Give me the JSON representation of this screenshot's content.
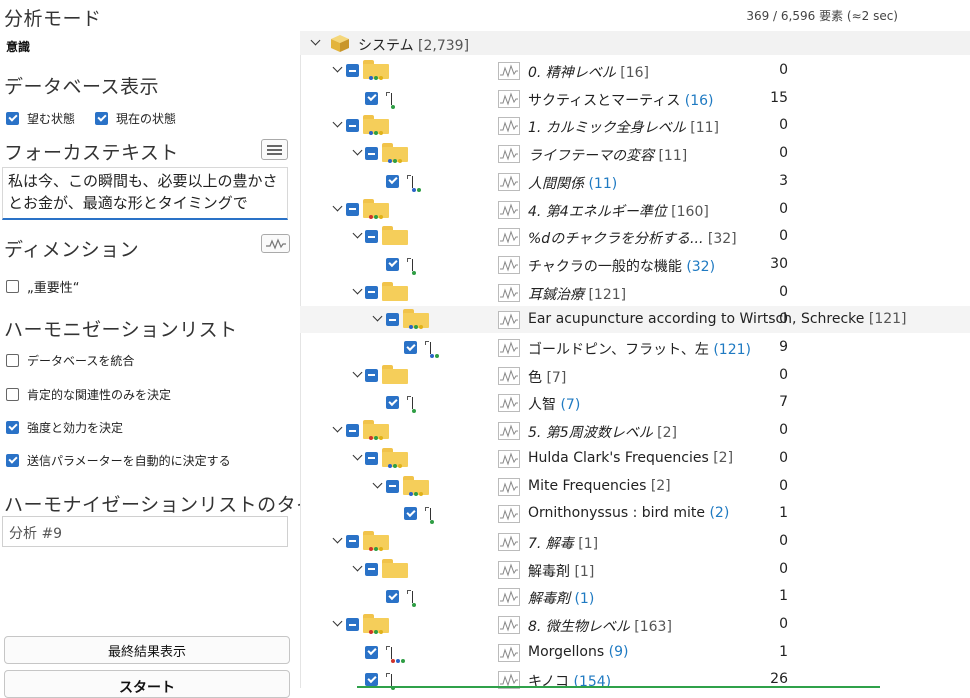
{
  "left": {
    "analysis_mode_title": "分析モード",
    "analysis_mode_value": "意識",
    "db_view_title": "データベース表示",
    "desired_state": "望む状態",
    "current_state": "現在の状態",
    "focus_text_title": "フォーカステキスト",
    "focus_text": "私は今、この瞬間も、必要以上の豊かさとお金が、最適な形とタイミングで",
    "dimension_title": "ディメンション",
    "importance": "„重要性“",
    "harmonization_title": "ハーモニゼーションリスト",
    "opt_merge_db": "データベースを統合",
    "opt_positive_only": "肯定的な関連性のみを決定",
    "opt_strength": "強度と効力を決定",
    "opt_auto_params": "送信パラメーターを自動的に決定する",
    "list_title_label": "ハーモナイゼーションリストのタイトル",
    "list_title_value": "分析 #9",
    "final_result_button": "最終結果表示",
    "start_button": "スタート",
    "checks": {
      "desired_state": true,
      "current_state": true,
      "importance": false,
      "merge_db": false,
      "positive_only": false,
      "strength": true,
      "auto_params": true
    }
  },
  "status": "369 / 6,596 要素 (≈2 sec)",
  "root": {
    "label": "システム",
    "count": "[2,739]"
  },
  "rows": [
    {
      "kind": "folder",
      "level": 1,
      "dots": [
        "#2b63c7",
        "#2f9e44",
        "#e0b21a"
      ],
      "value": "0",
      "label": "0. 精神レベル",
      "count": "[16]",
      "italic": true,
      "blue": false
    },
    {
      "kind": "leaf",
      "level": 2,
      "dots": [
        "#2f9e44"
      ],
      "value": "15",
      "label": "サクティスとマーティス",
      "count": "(16)",
      "italic": false,
      "blue": true
    },
    {
      "kind": "folder",
      "level": 1,
      "dots": [
        "#2b63c7",
        "#2f9e44",
        "#e0b21a"
      ],
      "value": "0",
      "label": "1. カルミック全身レベル",
      "count": "[11]",
      "italic": true,
      "blue": false
    },
    {
      "kind": "folder",
      "level": 2,
      "dots": [
        "#2b63c7",
        "#2f9e44",
        "#e0b21a"
      ],
      "value": "0",
      "label": "ライフテーマの変容",
      "count": "[11]",
      "italic": true,
      "blue": false
    },
    {
      "kind": "leaf",
      "level": 3,
      "dots": [
        "#2b63c7",
        "#2f9e44"
      ],
      "value": "3",
      "label": "人間関係",
      "count": "(11)",
      "italic": true,
      "blue": true
    },
    {
      "kind": "folder",
      "level": 1,
      "dots": [
        "#d0342c",
        "#2f9e44",
        "#e0b21a"
      ],
      "value": "0",
      "label": "4. 第4エネルギー準位",
      "count": "[160]",
      "italic": true,
      "blue": false
    },
    {
      "kind": "folder",
      "level": 2,
      "dots": [],
      "value": "0",
      "label": "%dのチャクラを分析する...",
      "count": "[32]",
      "italic": true,
      "blue": false
    },
    {
      "kind": "leaf",
      "level": 3,
      "dots": [
        "#2f9e44"
      ],
      "value": "30",
      "label": "チャクラの一般的な機能",
      "count": "(32)",
      "italic": false,
      "blue": true
    },
    {
      "kind": "folder",
      "level": 2,
      "dots": [],
      "value": "0",
      "label": "耳鍼治療",
      "count": "[121]",
      "italic": true,
      "blue": false
    },
    {
      "kind": "folder",
      "level": 3,
      "dots": [
        "#2b63c7",
        "#2f9e44",
        "#e0b21a"
      ],
      "value": "0",
      "label": "Ear acupuncture according to Wirtsch, Schrecke",
      "count": "[121]",
      "italic": false,
      "blue": false
    },
    {
      "kind": "leaf",
      "level": 4,
      "dots": [
        "#2b63c7",
        "#2f9e44"
      ],
      "value": "9",
      "label": "ゴールドピン、フラット、左",
      "count": "(121)",
      "italic": false,
      "blue": true
    },
    {
      "kind": "folder",
      "level": 2,
      "dots": [],
      "value": "0",
      "label": "色",
      "count": "[7]",
      "italic": false,
      "blue": false
    },
    {
      "kind": "leaf",
      "level": 3,
      "dots": [
        "#2f9e44"
      ],
      "value": "7",
      "label": "人智",
      "count": "(7)",
      "italic": false,
      "blue": true
    },
    {
      "kind": "folder",
      "level": 1,
      "dots": [
        "#d0342c",
        "#2f9e44",
        "#e0b21a"
      ],
      "value": "0",
      "label": "5. 第5周波数レベル",
      "count": "[2]",
      "italic": true,
      "blue": false
    },
    {
      "kind": "folder",
      "level": 2,
      "dots": [
        "#2b63c7",
        "#2f9e44",
        "#e0b21a"
      ],
      "value": "0",
      "label": "Hulda Clark's Frequencies",
      "count": "[2]",
      "italic": false,
      "blue": false
    },
    {
      "kind": "folder",
      "level": 3,
      "dots": [
        "#2b63c7",
        "#2f9e44",
        "#e0b21a"
      ],
      "value": "0",
      "label": "Mite Frequencies",
      "count": "[2]",
      "italic": false,
      "blue": false
    },
    {
      "kind": "leaf",
      "level": 4,
      "dots": [
        "#2f9e44"
      ],
      "value": "1",
      "label": "Ornithonyssus : bird mite",
      "count": "(2)",
      "italic": false,
      "blue": true
    },
    {
      "kind": "folder",
      "level": 1,
      "dots": [
        "#d0342c",
        "#2f9e44",
        "#e0b21a"
      ],
      "value": "0",
      "label": "7. 解毒",
      "count": "[1]",
      "italic": true,
      "blue": false
    },
    {
      "kind": "folder",
      "level": 2,
      "dots": [],
      "value": "0",
      "label": "解毒剤",
      "count": "[1]",
      "italic": false,
      "blue": false
    },
    {
      "kind": "leaf",
      "level": 3,
      "dots": [
        "#2f9e44"
      ],
      "value": "1",
      "label": "解毒剤",
      "count": "(1)",
      "italic": true,
      "blue": true
    },
    {
      "kind": "folder",
      "level": 1,
      "dots": [
        "#d0342c",
        "#2f9e44",
        "#e0b21a"
      ],
      "value": "0",
      "label": "8. 微生物レベル",
      "count": "[163]",
      "italic": true,
      "blue": false
    },
    {
      "kind": "leaf",
      "level": 2,
      "dots": [
        "#d0342c",
        "#2b63c7",
        "#2f9e44"
      ],
      "value": "1",
      "label": "Morgellons",
      "count": "(9)",
      "italic": false,
      "blue": true
    },
    {
      "kind": "leaf",
      "level": 2,
      "dots": [
        "#2f9e44"
      ],
      "value": "26",
      "label": "キノコ",
      "count": "(154)",
      "italic": false,
      "blue": true
    }
  ],
  "colors": {
    "accent": "#2a72c7",
    "folder": "#f5ce5a",
    "count_blue": "#1f7ac2",
    "progress": "#2fa14a"
  },
  "icons": {
    "list": "list-icon",
    "wave": "waveform-icon",
    "root": "cube-icon"
  }
}
